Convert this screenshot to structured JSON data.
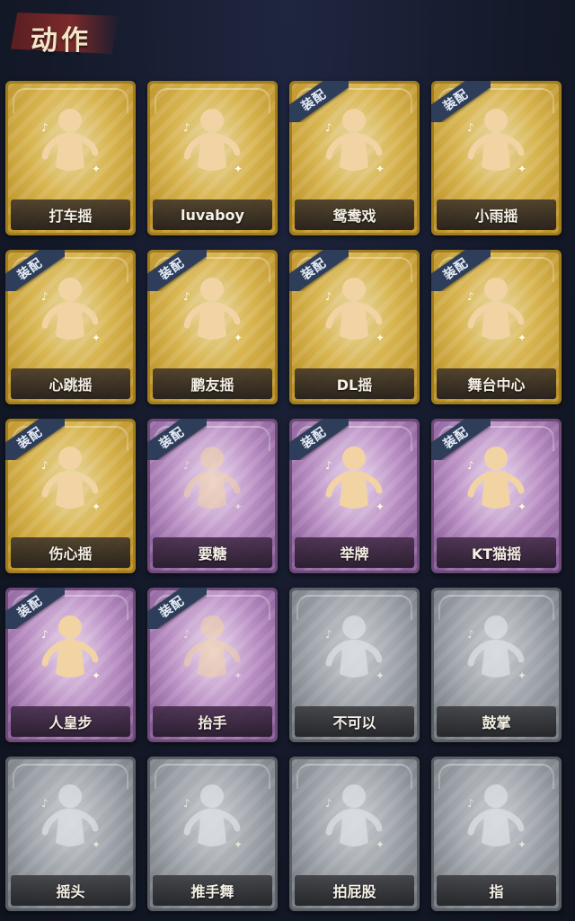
{
  "header": {
    "title": "动作"
  },
  "badge_text": "装配",
  "colors": {
    "gold": "#d8b550",
    "purple": "#b98ec3",
    "gray": "#9ea3aa",
    "badge": "#2e3e5a"
  },
  "emotes": [
    {
      "label": "打车摇",
      "tier": "gold",
      "equipped": false,
      "icon": "dance-pose-icon"
    },
    {
      "label": "luvaboy",
      "tier": "gold",
      "equipped": false,
      "icon": "dance-pose-icon"
    },
    {
      "label": "鸳鸯戏",
      "tier": "gold",
      "equipped": true,
      "icon": "dance-pose-icon"
    },
    {
      "label": "小雨摇",
      "tier": "gold",
      "equipped": true,
      "icon": "dance-pose-icon"
    },
    {
      "label": "心跳摇",
      "tier": "gold",
      "equipped": true,
      "icon": "dance-pose-icon"
    },
    {
      "label": "鹏友摇",
      "tier": "gold",
      "equipped": true,
      "icon": "dance-pose-icon"
    },
    {
      "label": "DL摇",
      "tier": "gold",
      "equipped": true,
      "icon": "dance-pose-icon"
    },
    {
      "label": "舞台中心",
      "tier": "gold",
      "equipped": true,
      "icon": "dance-pose-icon"
    },
    {
      "label": "伤心摇",
      "tier": "gold",
      "equipped": true,
      "icon": "heart-pose-icon"
    },
    {
      "label": "要糖",
      "tier": "purple",
      "equipped": true,
      "icon": "reach-pose-icon"
    },
    {
      "label": "举牌",
      "tier": "purple",
      "equipped": true,
      "icon": "sign-pose-icon"
    },
    {
      "label": "KT猫摇",
      "tier": "purple",
      "equipped": true,
      "icon": "dance-pose-icon"
    },
    {
      "label": "人皇步",
      "tier": "purple",
      "equipped": true,
      "icon": "dance-pose-icon"
    },
    {
      "label": "抬手",
      "tier": "purple",
      "equipped": true,
      "icon": "raise-hand-icon"
    },
    {
      "label": "不可以",
      "tier": "gray",
      "equipped": false,
      "icon": "finger-wag-icon"
    },
    {
      "label": "鼓掌",
      "tier": "gray",
      "equipped": false,
      "icon": "clap-icon"
    },
    {
      "label": "摇头",
      "tier": "gray",
      "equipped": false,
      "icon": "shake-head-icon"
    },
    {
      "label": "推手舞",
      "tier": "gray",
      "equipped": false,
      "icon": "push-dance-icon"
    },
    {
      "label": "拍屁股",
      "tier": "gray",
      "equipped": false,
      "icon": "pat-pose-icon"
    },
    {
      "label": "指",
      "tier": "gray",
      "equipped": false,
      "icon": "point-icon"
    }
  ]
}
